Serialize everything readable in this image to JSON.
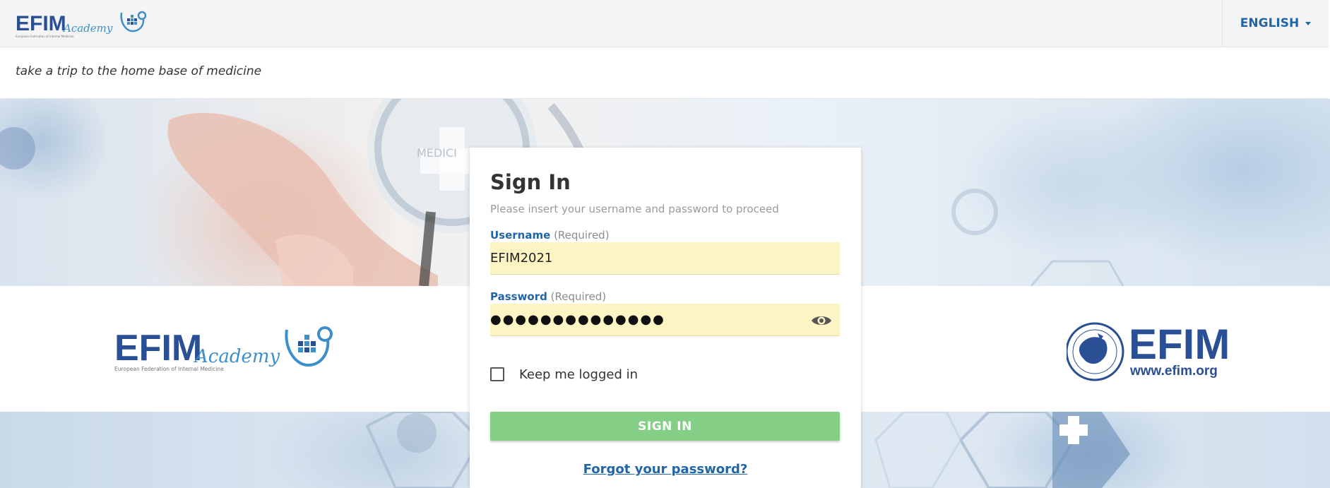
{
  "header": {
    "logo_text": "EFIM",
    "logo_script": "Academy",
    "logo_caption": "European Federation of Internal Medicine",
    "language_label": "ENGLISH"
  },
  "tagline": "take a trip to the home base of medicine",
  "hero": {
    "left_logo": {
      "text": "EFIM",
      "script": "Academy",
      "caption": "European Federation of Internal Medicine"
    },
    "right_logo": {
      "text": "EFIM",
      "url": "www.efim.org"
    },
    "stethoscope_text": "MEDICI"
  },
  "login": {
    "title": "Sign In",
    "subtitle": "Please insert your username and password to proceed",
    "username": {
      "label": "Username",
      "required": "(Required)",
      "value": "EFIM2021"
    },
    "password": {
      "label": "Password",
      "required": "(Required)",
      "masked_value": "●●●●●●●●●●●●●●"
    },
    "keep_logged_in": "Keep me logged in",
    "signin_label": "SIGN IN",
    "forgot_label": "Forgot your password?"
  },
  "colors": {
    "primary_blue": "#1f65a8",
    "logo_blue": "#2a4f94",
    "input_yellow": "#fdf4c3",
    "signin_green": "#84cf85"
  }
}
